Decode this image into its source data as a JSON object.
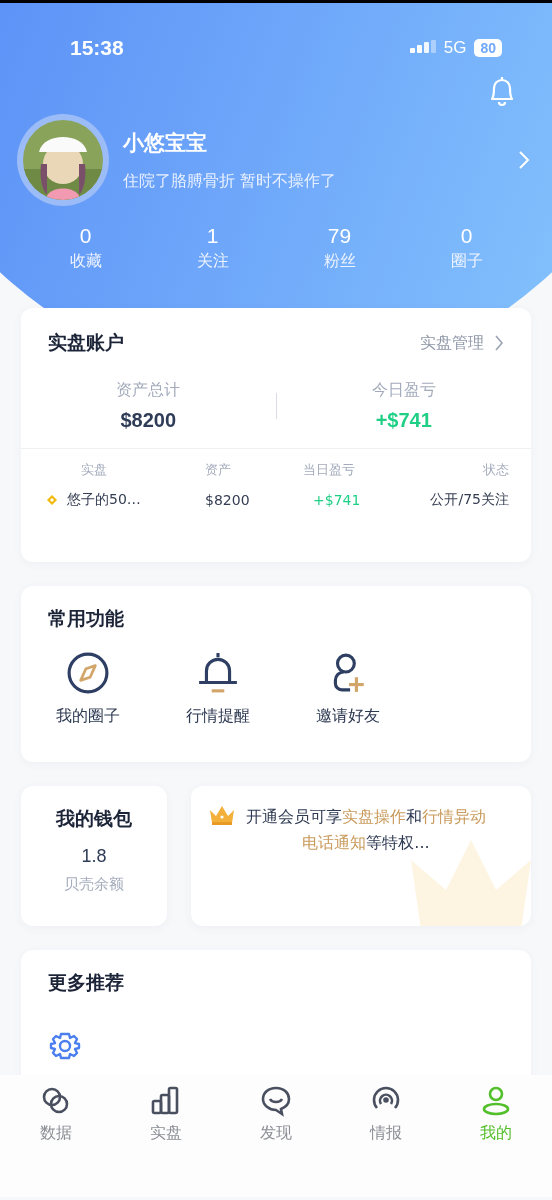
{
  "status_bar": {
    "time": "15:38",
    "network": "5G",
    "battery": "80"
  },
  "profile": {
    "name": "小悠宝宝",
    "bio": "住院了胳膊骨折 暂时不操作了"
  },
  "stats": [
    {
      "value": "0",
      "label": "收藏"
    },
    {
      "value": "1",
      "label": "关注"
    },
    {
      "value": "79",
      "label": "粉丝"
    },
    {
      "value": "0",
      "label": "圈子"
    }
  ],
  "account_card": {
    "title": "实盘账户",
    "link": "实盘管理",
    "summary": [
      {
        "label": "资产总计",
        "value": "$8200",
        "kind": "neutral"
      },
      {
        "label": "今日盈亏",
        "value": "+$741",
        "kind": "gain"
      }
    ],
    "columns": [
      "实盘",
      "资产",
      "当日盈亏",
      "状态"
    ],
    "rows": [
      {
        "name": "悠子的50…",
        "asset": "$8200",
        "pnl": "+$741",
        "kind": "gain",
        "status": "公开/75关注"
      }
    ]
  },
  "functions": {
    "title": "常用功能",
    "items": [
      {
        "label": "我的圈子",
        "kind": "compass"
      },
      {
        "label": "行情提醒",
        "kind": "bell"
      },
      {
        "label": "邀请好友",
        "kind": "invite"
      }
    ]
  },
  "wallet": {
    "title": "我的钱包",
    "value": "1.8",
    "label": "贝壳余额"
  },
  "promo": {
    "segments": [
      {
        "text": "开通会员可享",
        "highlight": false
      },
      {
        "text": "实盘操作",
        "highlight": true
      },
      {
        "text": "和",
        "highlight": false
      },
      {
        "text": "行情异动电话通知",
        "highlight": true
      },
      {
        "text": "等特权...",
        "highlight": false
      }
    ]
  },
  "more": {
    "title": "更多推荐"
  },
  "tabs": [
    {
      "label": "数据",
      "selected": false
    },
    {
      "label": "实盘",
      "selected": false
    },
    {
      "label": "发现",
      "selected": false
    },
    {
      "label": "情报",
      "selected": false
    },
    {
      "label": "我的",
      "selected": true
    }
  ]
}
